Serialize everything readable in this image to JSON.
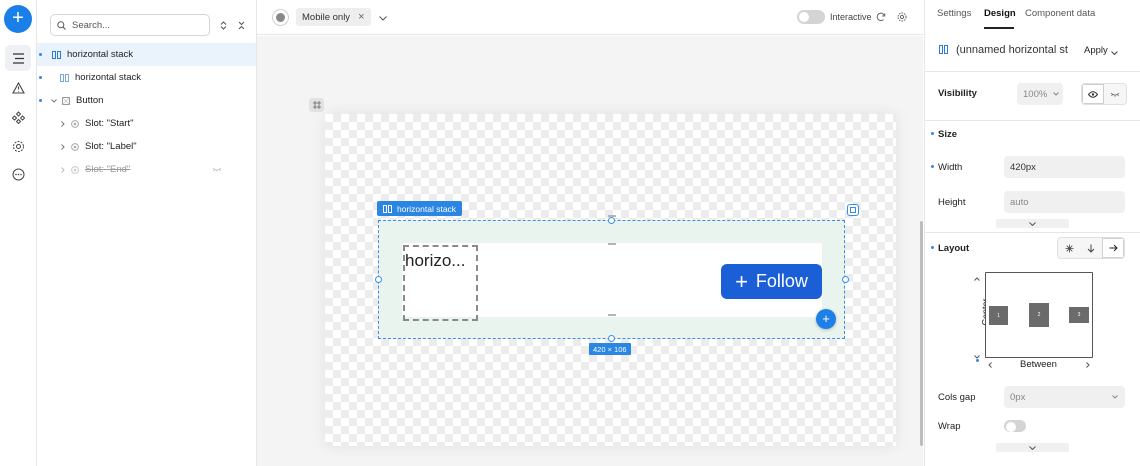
{
  "colors": {
    "accent": "#1a7fe6",
    "follow_button": "#1a5fd6",
    "selection": "#2a86e2"
  },
  "rail": {
    "items": [
      "layers-icon",
      "warning-icon",
      "components-icon",
      "settings-icon",
      "more-icon"
    ]
  },
  "layers": {
    "search_placeholder": "Search...",
    "rows": [
      {
        "label": "horizontal stack"
      },
      {
        "label": "horizontal stack"
      },
      {
        "label": "Button"
      },
      {
        "label": "Slot: \"Start\""
      },
      {
        "label": "Slot: \"Label\""
      },
      {
        "label": "Slot: \"End\""
      }
    ]
  },
  "toolbar": {
    "viewport_label": "Mobile only",
    "interactive_label": "Interactive"
  },
  "canvas": {
    "selection_label": "horizontal stack",
    "placeholder_text": "horizo...",
    "follow_label": "Follow",
    "dimensions": "420 × 106"
  },
  "props": {
    "tabs": [
      "Settings",
      "Design",
      "Component data"
    ],
    "component_name": "(unnamed horizontal st",
    "apply_label": "Apply",
    "visibility_label": "Visibility",
    "visibility_value": "100%",
    "size_label": "Size",
    "width_label": "Width",
    "width_value": "420px",
    "height_label": "Height",
    "height_value": "auto",
    "layout_label": "Layout",
    "align_vertical_label": "Center",
    "align_horizontal_label": "Between",
    "cols_gap_label": "Cols gap",
    "cols_gap_value": "0px",
    "wrap_label": "Wrap",
    "align_items": [
      "1",
      "2",
      "3"
    ]
  }
}
